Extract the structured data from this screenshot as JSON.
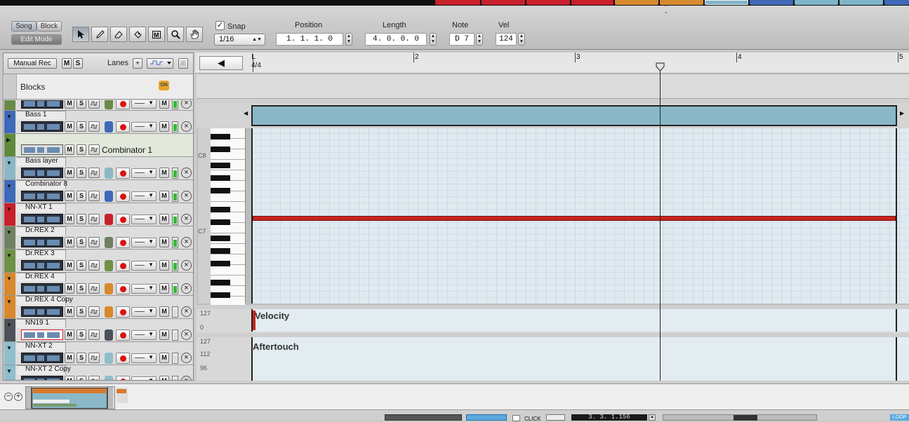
{
  "toolbar": {
    "mode_song": "Song",
    "mode_block": "Block",
    "edit_mode": "Edit Mode",
    "snap_label": "Snap",
    "snap_value": "1/16",
    "position_label": "Position",
    "position_value": "1.  1.  1.    0",
    "length_label": "Length",
    "length_value": "4.  0.  0.    0",
    "note_label": "Note",
    "note_value": "D 7",
    "vel_label": "Vel",
    "vel_value": "124"
  },
  "tracklist": {
    "manual_rec": "Manual Rec",
    "m": "M",
    "s": "S",
    "lanes": "Lanes",
    "plus": "+",
    "blocks": "Blocks",
    "blocks_on": "ON",
    "tracks": [
      {
        "name": "",
        "color": "#6a8a4a"
      },
      {
        "name": "Bass 1",
        "color": "#3f69b8"
      },
      {
        "name": "Combinator 1",
        "color": "#5f8a3c",
        "kind": "combinator"
      },
      {
        "name": "Bass layer",
        "color": "#8bb8c7"
      },
      {
        "name": "Combinator 8",
        "color": "#3f69b8"
      },
      {
        "name": "NN-XT 1",
        "color": "#c7202a"
      },
      {
        "name": "Dr.REX 2",
        "color": "#6f8062"
      },
      {
        "name": "Dr.REX 3",
        "color": "#6d9146"
      },
      {
        "name": "Dr.REX 4",
        "color": "#d7892b"
      },
      {
        "name": "Dr.REX 4 Copy",
        "color": "#d7892b"
      },
      {
        "name": "NN19 1",
        "color": "#4d5259"
      },
      {
        "name": "NN-XT 2",
        "color": "#8fbdcc"
      },
      {
        "name": "NN-XT 2 Copy",
        "color": "#8fbdcc"
      }
    ]
  },
  "ruler": {
    "bars": [
      "2",
      "3",
      "4",
      "5"
    ],
    "signature": "4/4"
  },
  "keys": {
    "c8": "C8",
    "c7": "C7"
  },
  "lanes_data": {
    "velocity": "Velocity",
    "velocity_max": "127",
    "velocity_min": "0",
    "aftertouch": "Aftertouch",
    "at_127": "127",
    "at_112": "112",
    "at_96": "96"
  },
  "bottom": {
    "click": "CLICK",
    "position": "3.  3.  1.156",
    "loop": "LOOP"
  }
}
